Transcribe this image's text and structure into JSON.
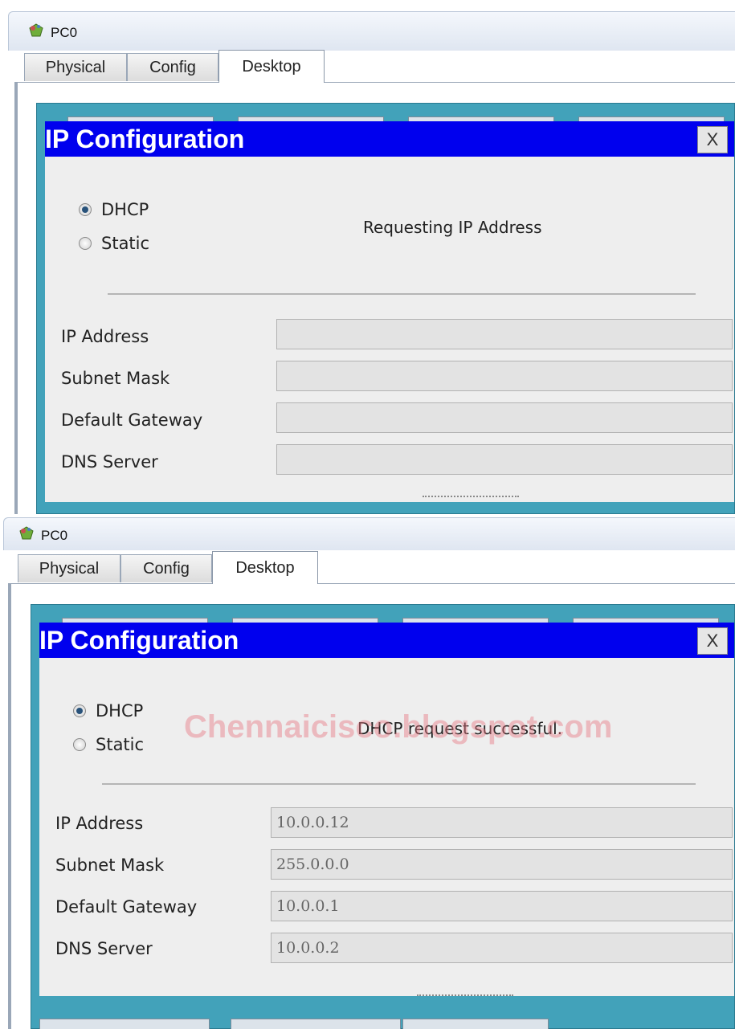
{
  "windows": [
    {
      "title": "PC0",
      "tabs": [
        "Physical",
        "Config",
        "Desktop"
      ],
      "active_tab": "Desktop",
      "dialog": {
        "title": "IP Configuration",
        "close_label": "X",
        "mode_options": [
          "DHCP",
          "Static"
        ],
        "selected_mode": "DHCP",
        "status": "Requesting IP Address",
        "fields": [
          {
            "label": "IP Address",
            "value": ""
          },
          {
            "label": "Subnet Mask",
            "value": ""
          },
          {
            "label": "Default Gateway",
            "value": ""
          },
          {
            "label": "DNS Server",
            "value": ""
          }
        ]
      }
    },
    {
      "title": "PC0",
      "tabs": [
        "Physical",
        "Config",
        "Desktop"
      ],
      "active_tab": "Desktop",
      "dialog": {
        "title": "IP Configuration",
        "close_label": "X",
        "mode_options": [
          "DHCP",
          "Static"
        ],
        "selected_mode": "DHCP",
        "status": "DHCP request successful.",
        "watermark": "Chennaicisco.blogspot.com",
        "fields": [
          {
            "label": "IP Address",
            "value": "10.0.0.12"
          },
          {
            "label": "Subnet Mask",
            "value": "255.0.0.0"
          },
          {
            "label": "Default Gateway",
            "value": "10.0.0.1"
          },
          {
            "label": "DNS Server",
            "value": "10.0.0.2"
          }
        ]
      }
    }
  ],
  "colors": {
    "dialog_header": "#0000ee",
    "desktop_background": "#42a2ba",
    "dialog_body": "#eeeeee"
  },
  "icons": [
    "pc-icon",
    "close-icon",
    "radio-icon"
  ]
}
